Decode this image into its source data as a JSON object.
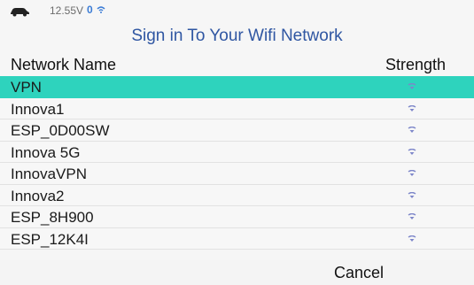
{
  "status": {
    "voltage": "12.55V",
    "bt_badge": "0",
    "wifi_icon": "wifi-icon",
    "car_icon": "car-icon"
  },
  "dialog": {
    "title": "Sign in To Your Wifi Network",
    "columns": {
      "name": "Network Name",
      "strength": "Strength"
    }
  },
  "networks": [
    {
      "name": "VPN",
      "selected": true,
      "signal_icon": "wifi-signal-icon"
    },
    {
      "name": "Innova1",
      "selected": false,
      "signal_icon": "wifi-signal-icon"
    },
    {
      "name": "ESP_0D00SW",
      "selected": false,
      "signal_icon": "wifi-signal-icon"
    },
    {
      "name": "Innova 5G",
      "selected": false,
      "signal_icon": "wifi-signal-icon"
    },
    {
      "name": "InnovaVPN",
      "selected": false,
      "signal_icon": "wifi-signal-icon"
    },
    {
      "name": "Innova2",
      "selected": false,
      "signal_icon": "wifi-signal-icon"
    },
    {
      "name": "ESP_8H900",
      "selected": false,
      "signal_icon": "wifi-signal-icon"
    },
    {
      "name": "ESP_12K4I",
      "selected": false,
      "signal_icon": "wifi-signal-icon"
    }
  ],
  "footer": {
    "cancel_label": "Cancel"
  },
  "colors": {
    "title": "#2f56a2",
    "selected_row": "#2ed3bd",
    "signal": "#7d86c9",
    "bt_badge": "#3a7bd5"
  }
}
